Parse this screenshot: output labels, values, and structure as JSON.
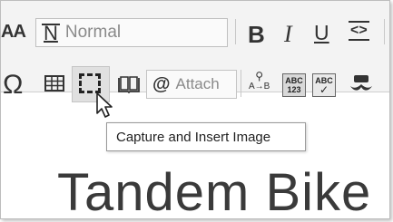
{
  "toolbar": {
    "font_size_label": "AA",
    "style_dropdown": {
      "icon_label": "N",
      "selected": "Normal"
    },
    "bold_label": "B",
    "italic_label": "I",
    "underline_label": "U",
    "code_label": "<>",
    "omega_label": "Ω",
    "attach_label": "Attach",
    "find_replace_label": "A→B",
    "spell_label_1": "ABC",
    "spell_label_1b": "123",
    "spell_label_2": "ABC"
  },
  "tooltip": {
    "text": "Capture and Insert Image"
  },
  "document": {
    "title_partial": "Tandem Bike F"
  }
}
